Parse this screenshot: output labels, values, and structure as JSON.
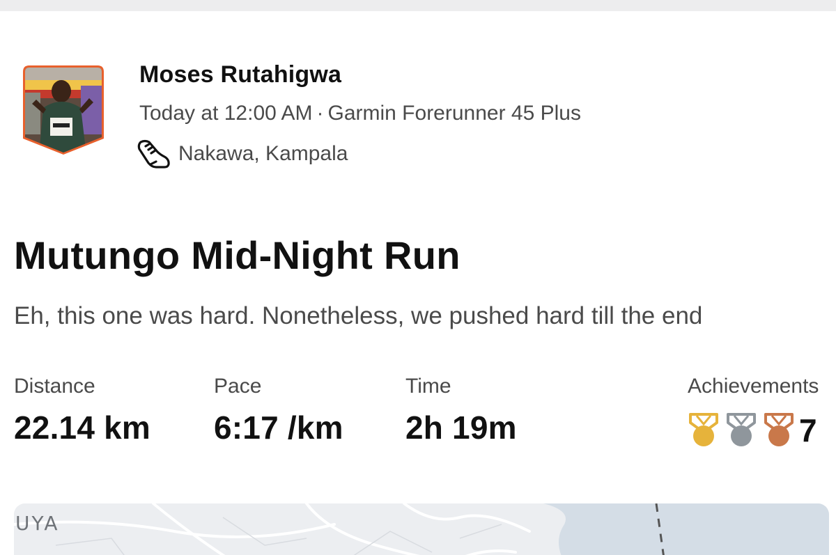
{
  "athlete": {
    "name": "Moses Rutahigwa",
    "timestamp": "Today at 12:00 AM",
    "separator": "·",
    "device": "Garmin Forerunner 45 Plus",
    "activity_icon": "running-shoe-icon",
    "location": "Nakawa, Kampala"
  },
  "activity": {
    "title": "Mutungo Mid-Night Run",
    "description": "Eh, this one was hard. Nonetheless, we pushed hard till the end"
  },
  "stats": {
    "distance": {
      "label": "Distance",
      "value": "22.14 km"
    },
    "pace": {
      "label": "Pace",
      "value": "6:17 /km"
    },
    "time": {
      "label": "Time",
      "value": "2h 19m"
    },
    "achievements": {
      "label": "Achievements",
      "count": "7",
      "medals": [
        "gold-medal-icon",
        "silver-medal-icon",
        "bronze-medal-icon"
      ]
    }
  },
  "map": {
    "label": "UYA"
  },
  "colors": {
    "avatar_border": "#e8602c",
    "gold": "#e6b33b",
    "silver": "#8f969c",
    "bronze": "#c9784a",
    "water": "#d4dde6",
    "map_bg": "#eceef1"
  }
}
